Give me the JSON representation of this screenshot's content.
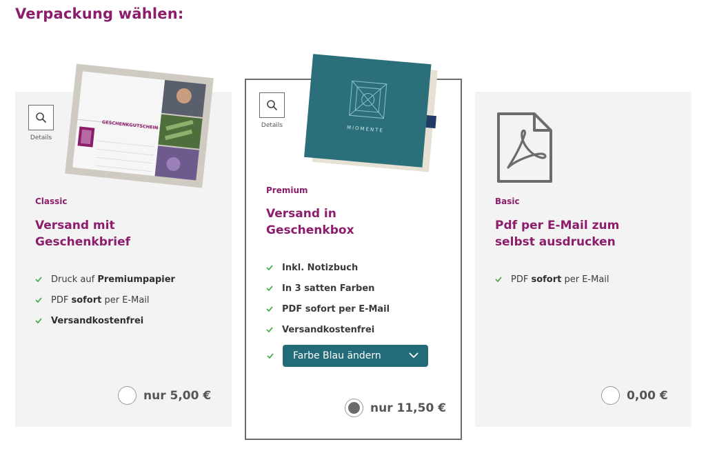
{
  "page": {
    "title": "Verpackung wählen:"
  },
  "details_label": "Details",
  "options": [
    {
      "tier": "Classic",
      "headline_1": "Versand mit",
      "headline_2": "Geschenkbrief",
      "features": [
        {
          "pre": "Druck auf ",
          "strong": "Premiumpapier",
          "post": ""
        },
        {
          "pre": "PDF ",
          "strong": "sofort",
          "post": " per E-Mail"
        },
        {
          "pre": "",
          "strong": "Versandkostenfrei",
          "post": ""
        }
      ],
      "price": "nur 5,00 €",
      "selected": false,
      "voucher_text": "GESCHENKGUTSCHEIN"
    },
    {
      "tier": "Premium",
      "headline_1": "Versand in",
      "headline_2": "Geschenkbox",
      "features": [
        "Inkl. Notizbuch",
        "In 3 satten Farben",
        "PDF sofort per E-Mail",
        "Versandkostenfrei"
      ],
      "color_select": {
        "label": "Farbe Blau ändern",
        "icon": "chevron-down-icon"
      },
      "price": "nur 11,50 €",
      "selected": true,
      "box_brand": "MIOMENTE"
    },
    {
      "tier": "Basic",
      "headline_1": "Pdf per E-Mail zum",
      "headline_2": "selbst ausdrucken",
      "features": [
        {
          "pre": "PDF ",
          "strong": "sofort",
          "post": " per E-Mail"
        }
      ],
      "price": "0,00 €",
      "selected": false
    }
  ],
  "colors": {
    "accent": "#8c1d6c",
    "check": "#4caf50",
    "select_bg": "#236b78",
    "box": "#2b6f7b"
  }
}
